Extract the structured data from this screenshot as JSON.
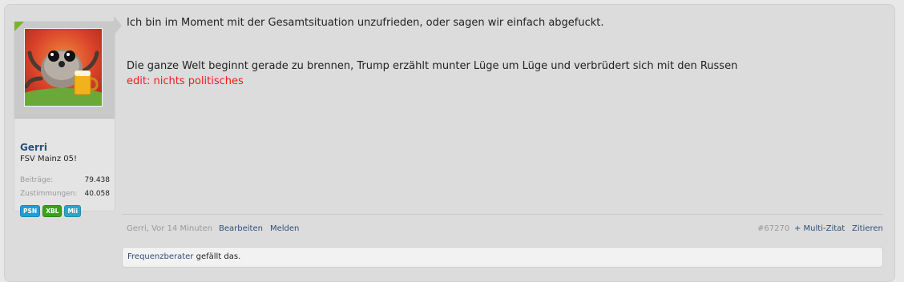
{
  "post": {
    "user": {
      "name": "Gerri",
      "title": "FSV Mainz 05!",
      "stats": [
        {
          "label": "Beiträge:",
          "value": "79.438"
        },
        {
          "label": "Zustimmungen:",
          "value": "40.058"
        }
      ],
      "badges": [
        {
          "label": "PSN",
          "color": "#1e9ed8"
        },
        {
          "label": "XBL",
          "color": "#3aa01e"
        },
        {
          "label": "Mii",
          "color": "#2aa5c8"
        }
      ],
      "avatar_icon": "spider-with-beer-avatar"
    },
    "message": {
      "line1": "Ich bin im Moment mit der Gesamtsituation unzufrieden, oder sagen wir einfach abgefuckt.",
      "line2": "Die ganze Welt beginnt gerade zu brennen, Trump erzählt munter Lüge um Lüge und verbrüdert sich mit den Russen",
      "edit_note": "edit: nichts politisches",
      "edit_color": "#ee1b1b"
    },
    "footer": {
      "author_time": "Gerri, Vor 14 Minuten",
      "edit_label": "Bearbeiten",
      "report_label": "Melden",
      "post_number": "#67270",
      "multiquote_label": "+ Multi-Zitat",
      "quote_label": "Zitieren"
    },
    "likes": {
      "liker": "Frequenzberater",
      "suffix": " gefällt das."
    }
  }
}
